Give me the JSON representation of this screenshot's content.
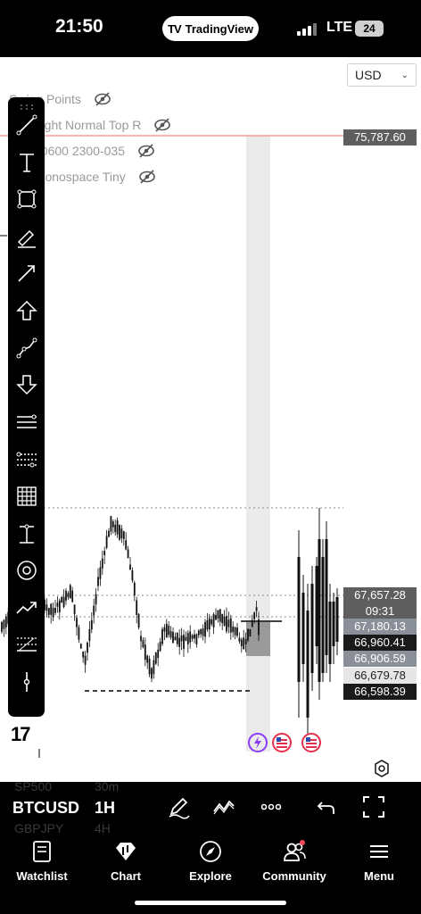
{
  "status_bar": {
    "time": "21:50",
    "app_pill": "TradingView",
    "network": "LTE",
    "battery": "24"
  },
  "chart": {
    "currency": "USD",
    "indicators": [
      {
        "label": "Swing Points"
      },
      {
        "label": "Top Right Normal Top R"
      },
      {
        "label": "0300-0600 2300-035"
      },
      {
        "label": "Hl... Monospace Tiny"
      }
    ],
    "price_tags": [
      {
        "value": "75,787.60",
        "color": "#5e5e5e"
      },
      {
        "value": "67,657.28",
        "color": "#5e5e5e"
      },
      {
        "value": "09:31",
        "color": "#5e5e5e"
      },
      {
        "value": "67,180.13",
        "color": "#8a8f99"
      },
      {
        "value": "66,960.41",
        "color": "#1a1a1a"
      },
      {
        "value": "66,906.59",
        "color": "#8a8f99"
      },
      {
        "value": "66,679.78",
        "color": "#e6e6e6"
      },
      {
        "value": "66,598.39",
        "color": "#1a1a1a"
      }
    ]
  },
  "toolbar": {
    "tools": [
      "trend-line-icon",
      "text-icon",
      "rectangle-icon",
      "brush-icon",
      "arrow-icon",
      "arrow-up-icon",
      "path-icon",
      "arrow-down-icon",
      "horizontal-lines-icon",
      "pitchfork-icon",
      "gann-grid-icon",
      "long-position-icon",
      "cycle-icon",
      "forecast-icon",
      "fib-retracement-icon",
      "anchor-icon"
    ]
  },
  "symbol_bar": {
    "symbol": "BTCUSD",
    "timeframe": "1H",
    "ghost_above": [
      "SP500",
      "30m"
    ],
    "ghost_below": [
      "GBPJPY",
      "4H"
    ]
  },
  "tabs": [
    {
      "label": "Watchlist",
      "icon": "book-icon"
    },
    {
      "label": "Chart",
      "icon": "chart-icon"
    },
    {
      "label": "Explore",
      "icon": "compass-icon"
    },
    {
      "label": "Community",
      "icon": "people-icon"
    },
    {
      "label": "Menu",
      "icon": "hamburger-icon"
    }
  ]
}
